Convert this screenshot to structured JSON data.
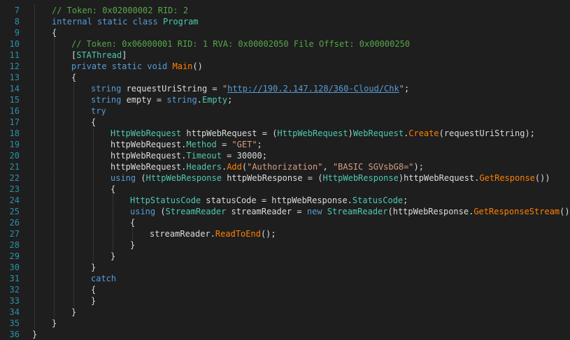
{
  "colors": {
    "background": "#1e1e1e",
    "line_number": "#2b91af",
    "keyword": "#569cd6",
    "type": "#4ec9b0",
    "comment": "#57a64a",
    "string": "#d69d85",
    "method": "#ff8000",
    "text": "#dcdcdc"
  },
  "lines": [
    {
      "n": "7",
      "indent": 1,
      "tokens": [
        {
          "t": "// Token: 0x02000002 RID: 2",
          "c": "cm"
        }
      ]
    },
    {
      "n": "8",
      "indent": 1,
      "tokens": [
        {
          "t": "internal static class ",
          "c": "kw"
        },
        {
          "t": "Program",
          "c": "ty"
        }
      ]
    },
    {
      "n": "9",
      "indent": 1,
      "tokens": [
        {
          "t": "{",
          "c": "plain"
        }
      ]
    },
    {
      "n": "10",
      "indent": 2,
      "tokens": [
        {
          "t": "// Token: 0x06000001 RID: 1 RVA: 0x00002050 File Offset: 0x00000250",
          "c": "cm"
        }
      ]
    },
    {
      "n": "11",
      "indent": 2,
      "tokens": [
        {
          "t": "[",
          "c": "plain"
        },
        {
          "t": "STAThread",
          "c": "ty"
        },
        {
          "t": "]",
          "c": "plain"
        }
      ]
    },
    {
      "n": "12",
      "indent": 2,
      "tokens": [
        {
          "t": "private static void ",
          "c": "kw"
        },
        {
          "t": "Main",
          "c": "meth"
        },
        {
          "t": "()",
          "c": "plain"
        }
      ]
    },
    {
      "n": "13",
      "indent": 2,
      "tokens": [
        {
          "t": "{",
          "c": "plain"
        }
      ]
    },
    {
      "n": "14",
      "indent": 3,
      "tokens": [
        {
          "t": "string ",
          "c": "kw"
        },
        {
          "t": "requestUriString = ",
          "c": "plain"
        },
        {
          "t": "\"",
          "c": "st"
        },
        {
          "t": "http://190.2.147.128/360-Cloud/Chk",
          "c": "url"
        },
        {
          "t": "\"",
          "c": "st"
        },
        {
          "t": ";",
          "c": "plain"
        }
      ]
    },
    {
      "n": "15",
      "indent": 3,
      "tokens": [
        {
          "t": "string ",
          "c": "kw"
        },
        {
          "t": "empty = ",
          "c": "plain"
        },
        {
          "t": "string",
          "c": "kw"
        },
        {
          "t": ".",
          "c": "plain"
        },
        {
          "t": "Empty",
          "c": "mem"
        },
        {
          "t": ";",
          "c": "plain"
        }
      ]
    },
    {
      "n": "16",
      "indent": 3,
      "tokens": [
        {
          "t": "try",
          "c": "kw"
        }
      ]
    },
    {
      "n": "17",
      "indent": 3,
      "tokens": [
        {
          "t": "{",
          "c": "plain"
        }
      ]
    },
    {
      "n": "18",
      "indent": 4,
      "tokens": [
        {
          "t": "HttpWebRequest ",
          "c": "ty"
        },
        {
          "t": "httpWebRequest = (",
          "c": "plain"
        },
        {
          "t": "HttpWebRequest",
          "c": "ty"
        },
        {
          "t": ")",
          "c": "plain"
        },
        {
          "t": "WebRequest",
          "c": "ty"
        },
        {
          "t": ".",
          "c": "plain"
        },
        {
          "t": "Create",
          "c": "meth"
        },
        {
          "t": "(requestUriString);",
          "c": "plain"
        }
      ]
    },
    {
      "n": "19",
      "indent": 4,
      "tokens": [
        {
          "t": "httpWebRequest.",
          "c": "plain"
        },
        {
          "t": "Method",
          "c": "mem"
        },
        {
          "t": " = ",
          "c": "plain"
        },
        {
          "t": "\"GET\"",
          "c": "st"
        },
        {
          "t": ";",
          "c": "plain"
        }
      ]
    },
    {
      "n": "20",
      "indent": 4,
      "tokens": [
        {
          "t": "httpWebRequest.",
          "c": "plain"
        },
        {
          "t": "Timeout",
          "c": "mem"
        },
        {
          "t": " = 30000;",
          "c": "plain"
        }
      ]
    },
    {
      "n": "21",
      "indent": 4,
      "tokens": [
        {
          "t": "httpWebRequest.",
          "c": "plain"
        },
        {
          "t": "Headers",
          "c": "mem"
        },
        {
          "t": ".",
          "c": "plain"
        },
        {
          "t": "Add",
          "c": "meth"
        },
        {
          "t": "(",
          "c": "plain"
        },
        {
          "t": "\"Authorization\"",
          "c": "st"
        },
        {
          "t": ", ",
          "c": "plain"
        },
        {
          "t": "\"BASIC SGVsbG8=\"",
          "c": "st"
        },
        {
          "t": ");",
          "c": "plain"
        }
      ]
    },
    {
      "n": "22",
      "indent": 4,
      "tokens": [
        {
          "t": "using ",
          "c": "kw"
        },
        {
          "t": "(",
          "c": "plain"
        },
        {
          "t": "HttpWebResponse ",
          "c": "ty"
        },
        {
          "t": "httpWebResponse = (",
          "c": "plain"
        },
        {
          "t": "HttpWebResponse",
          "c": "ty"
        },
        {
          "t": ")httpWebRequest.",
          "c": "plain"
        },
        {
          "t": "GetResponse",
          "c": "meth"
        },
        {
          "t": "())",
          "c": "plain"
        }
      ]
    },
    {
      "n": "23",
      "indent": 4,
      "tokens": [
        {
          "t": "{",
          "c": "plain"
        }
      ]
    },
    {
      "n": "24",
      "indent": 5,
      "tokens": [
        {
          "t": "HttpStatusCode ",
          "c": "ty"
        },
        {
          "t": "statusCode = httpWebResponse.",
          "c": "plain"
        },
        {
          "t": "StatusCode",
          "c": "mem"
        },
        {
          "t": ";",
          "c": "plain"
        }
      ]
    },
    {
      "n": "25",
      "indent": 5,
      "tokens": [
        {
          "t": "using ",
          "c": "kw"
        },
        {
          "t": "(",
          "c": "plain"
        },
        {
          "t": "StreamReader ",
          "c": "ty"
        },
        {
          "t": "streamReader = ",
          "c": "plain"
        },
        {
          "t": "new ",
          "c": "kw"
        },
        {
          "t": "StreamReader",
          "c": "ty"
        },
        {
          "t": "(httpWebResponse.",
          "c": "plain"
        },
        {
          "t": "GetResponseStream",
          "c": "meth"
        },
        {
          "t": "()))",
          "c": "plain"
        }
      ]
    },
    {
      "n": "26",
      "indent": 5,
      "tokens": [
        {
          "t": "{",
          "c": "plain"
        }
      ]
    },
    {
      "n": "27",
      "indent": 6,
      "tokens": [
        {
          "t": "streamReader.",
          "c": "plain"
        },
        {
          "t": "ReadToEnd",
          "c": "meth"
        },
        {
          "t": "();",
          "c": "plain"
        }
      ]
    },
    {
      "n": "28",
      "indent": 5,
      "tokens": [
        {
          "t": "}",
          "c": "plain"
        }
      ]
    },
    {
      "n": "29",
      "indent": 4,
      "tokens": [
        {
          "t": "}",
          "c": "plain"
        }
      ]
    },
    {
      "n": "30",
      "indent": 3,
      "tokens": [
        {
          "t": "}",
          "c": "plain"
        }
      ]
    },
    {
      "n": "31",
      "indent": 3,
      "tokens": [
        {
          "t": "catch",
          "c": "kw"
        }
      ]
    },
    {
      "n": "32",
      "indent": 3,
      "tokens": [
        {
          "t": "{",
          "c": "plain"
        }
      ]
    },
    {
      "n": "33",
      "indent": 3,
      "tokens": [
        {
          "t": "}",
          "c": "plain"
        }
      ]
    },
    {
      "n": "34",
      "indent": 2,
      "tokens": [
        {
          "t": "}",
          "c": "plain"
        }
      ]
    },
    {
      "n": "35",
      "indent": 1,
      "tokens": [
        {
          "t": "}",
          "c": "plain"
        }
      ]
    },
    {
      "n": "36",
      "indent": 0,
      "tokens": [
        {
          "t": "}",
          "c": "plain"
        }
      ]
    }
  ]
}
